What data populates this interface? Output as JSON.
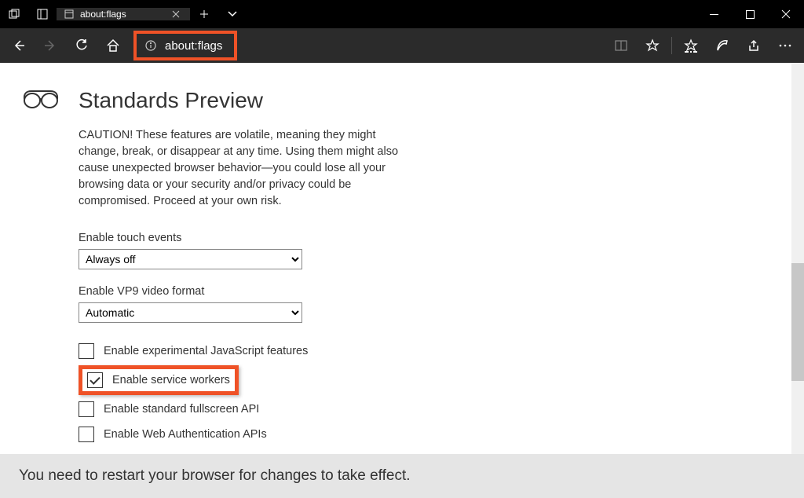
{
  "tab": {
    "title": "about:flags"
  },
  "address": {
    "url": "about:flags"
  },
  "page": {
    "heading": "Standards Preview",
    "caution": "CAUTION! These features are volatile, meaning they might change, break, or disappear at any time. Using them might also cause unexpected browser behavior—you could lose all your browsing data or your security and/or privacy could be compromised. Proceed at your own risk.",
    "fields": {
      "touch_label": "Enable touch events",
      "touch_value": "Always off",
      "vp9_label": "Enable VP9 video format",
      "vp9_value": "Automatic"
    },
    "checkboxes": {
      "js": {
        "label": "Enable experimental JavaScript features",
        "checked": false
      },
      "sw": {
        "label": "Enable service workers",
        "checked": true
      },
      "fs": {
        "label": "Enable standard fullscreen API",
        "checked": false
      },
      "webauthn": {
        "label": "Enable Web Authentication APIs",
        "checked": false
      }
    }
  },
  "footer": {
    "message": "You need to restart your browser for changes to take effect."
  }
}
